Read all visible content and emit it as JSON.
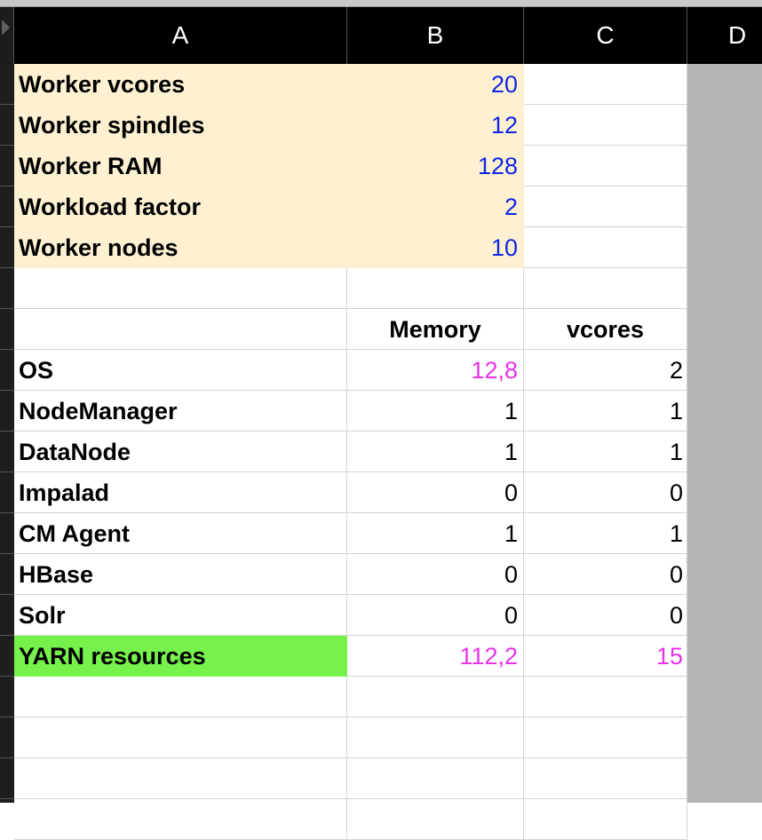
{
  "columns": [
    "A",
    "B",
    "C",
    "D"
  ],
  "colors": {
    "input_fill": "#fdf1d1",
    "input_value": "#1025e6",
    "result_value": "#e534e8",
    "highlight_fill": "#77f24d",
    "plain_value": "#000000"
  },
  "inputs": [
    {
      "label": "Worker vcores",
      "value": "20"
    },
    {
      "label": "Worker spindles",
      "value": "12"
    },
    {
      "label": "Worker RAM",
      "value": "128"
    },
    {
      "label": "Workload factor",
      "value": "2"
    },
    {
      "label": "Worker nodes",
      "value": "10"
    }
  ],
  "table_header": {
    "memory": "Memory",
    "vcores": "vcores"
  },
  "rows": [
    {
      "label": "OS",
      "memory": "12,8",
      "vcores": "2"
    },
    {
      "label": "NodeManager",
      "memory": "1",
      "vcores": "1"
    },
    {
      "label": "DataNode",
      "memory": "1",
      "vcores": "1"
    },
    {
      "label": "Impalad",
      "memory": "0",
      "vcores": "0"
    },
    {
      "label": "CM Agent",
      "memory": "1",
      "vcores": "1"
    },
    {
      "label": "HBase",
      "memory": "0",
      "vcores": "0"
    },
    {
      "label": "Solr",
      "memory": "0",
      "vcores": "0"
    }
  ],
  "yarn": {
    "label": "YARN resources",
    "memory": "112,2",
    "vcores": "15"
  }
}
